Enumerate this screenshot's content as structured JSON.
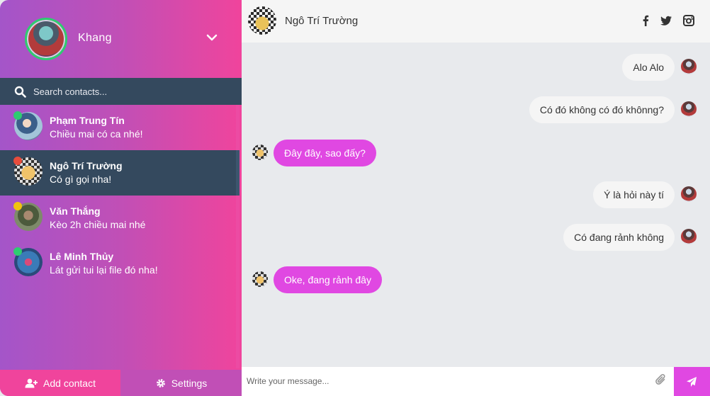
{
  "user": {
    "name": "Khang"
  },
  "search": {
    "placeholder": "Search contacts..."
  },
  "contacts": [
    {
      "name": "Phạm Trung Tín",
      "last_message": "Chiều mai có ca nhé!",
      "status_color": "#2ecc71",
      "active": false
    },
    {
      "name": "Ngô Trí Trường",
      "last_message": "Có gì gọi nha!",
      "status_color": "#e74c3c",
      "active": true
    },
    {
      "name": "Văn Thắng",
      "last_message": "Kèo 2h chiều mai nhé",
      "status_color": "#f1c40f",
      "active": false
    },
    {
      "name": "Lê Minh Thủy",
      "last_message": "Lát gửi tui lại file đó nha!",
      "status_color": "#2ecc71",
      "active": false
    }
  ],
  "bottom": {
    "add_contact_label": "Add contact",
    "settings_label": "Settings"
  },
  "chat": {
    "contact_name": "Ngô Trí Trường",
    "social_icons": [
      "facebook-icon",
      "twitter-icon",
      "instagram-icon"
    ],
    "messages": [
      {
        "direction": "sent",
        "text": "Alo Alo"
      },
      {
        "direction": "sent",
        "text": "Có đó không có đó khônng?"
      },
      {
        "direction": "received",
        "text": "Đây đây, sao đấy?"
      },
      {
        "direction": "sent",
        "text": "Ý là hỏi này tí"
      },
      {
        "direction": "sent",
        "text": "Có đang rảnh không"
      },
      {
        "direction": "received",
        "text": "Oke, đang rảnh đây"
      }
    ]
  },
  "composer": {
    "placeholder": "Write your message..."
  },
  "colors": {
    "sidebar_gradient_start": "#a455c9",
    "sidebar_gradient_end": "#f0449c",
    "dark_panel": "#34495e",
    "received_bubble": "#e048e2",
    "sent_bubble": "#f5f5f5",
    "chat_background": "#e8eaed"
  }
}
